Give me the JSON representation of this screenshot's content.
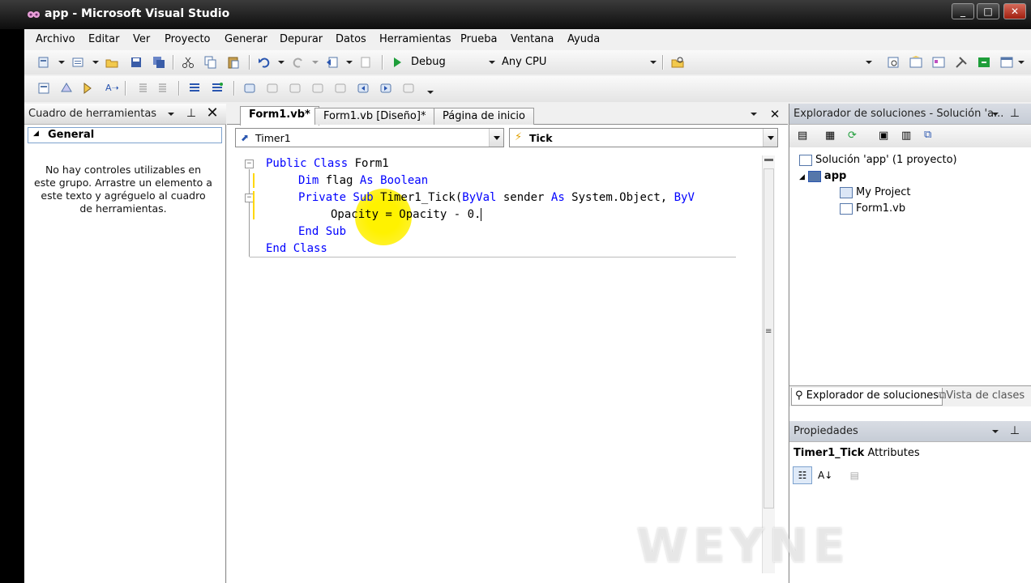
{
  "window": {
    "title": "app - Microsoft Visual Studio"
  },
  "menu": [
    "Archivo",
    "Editar",
    "Ver",
    "Proyecto",
    "Generar",
    "Depurar",
    "Datos",
    "Herramientas",
    "Prueba",
    "Ventana",
    "Ayuda"
  ],
  "toolbar": {
    "config": "Debug",
    "platform": "Any CPU"
  },
  "toolbox": {
    "title": "Cuadro de herramientas",
    "group": "General",
    "empty_message": "No hay controles utilizables en este grupo. Arrastre un elemento a este texto y agréguelo al cuadro de herramientas."
  },
  "editor": {
    "tabs": [
      "Form1.vb*",
      "Form1.vb [Diseño]*",
      "Página de inicio"
    ],
    "object_combo": "Timer1",
    "event_combo": "Tick",
    "code": [
      [
        "Public Class",
        " Form1"
      ],
      [
        "Dim",
        " flag ",
        "As Boolean"
      ],
      [
        "Private Sub",
        " Timer1_Tick(",
        "ByVal",
        " sender ",
        "As",
        " System.Object, ",
        "ByV"
      ],
      [
        "",
        "Opacity = Opacity - 0."
      ],
      [
        "End Sub"
      ],
      [
        "End Class"
      ]
    ]
  },
  "solution_explorer": {
    "title": "Explorador de soluciones - Solución 'a...",
    "solution": "Solución 'app' (1 proyecto)",
    "project": "app",
    "items": [
      "My Project",
      "Form1.vb"
    ],
    "tabs": [
      "Explorador de soluciones",
      "Vista de clases"
    ]
  },
  "properties": {
    "title": "Propiedades",
    "selected_name": "Timer1_Tick",
    "selected_type": "Attributes"
  },
  "watermark": "WEYNE",
  "colors": {
    "keyword": "#0000ff",
    "highlight": "#fff200",
    "changebar": "#ffd700"
  }
}
